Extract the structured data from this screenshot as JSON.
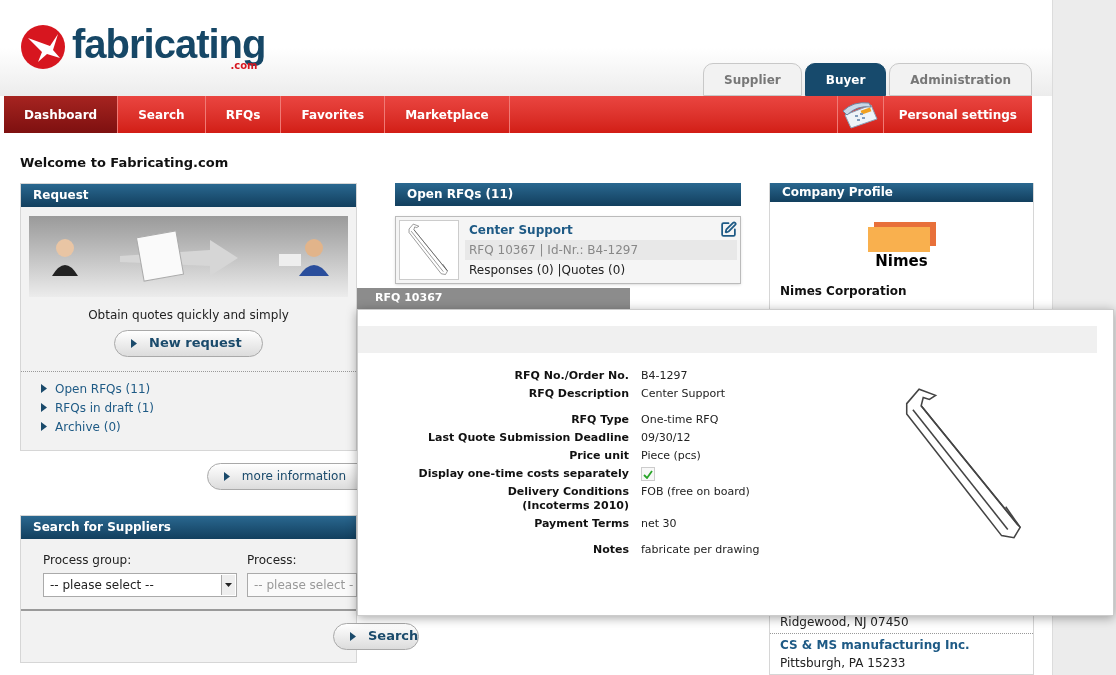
{
  "logo": {
    "name": "fabricating",
    "suffix": ".com"
  },
  "role_tabs": [
    {
      "label": "Supplier",
      "selected": false
    },
    {
      "label": "Buyer",
      "selected": true
    },
    {
      "label": "Administration",
      "selected": false
    }
  ],
  "nav": {
    "items": [
      {
        "label": "Dashboard",
        "selected": true
      },
      {
        "label": "Search",
        "selected": false
      },
      {
        "label": "RFQs",
        "selected": false
      },
      {
        "label": "Favorites",
        "selected": false
      },
      {
        "label": "Marketplace",
        "selected": false
      }
    ],
    "personal_settings": "Personal settings"
  },
  "welcome": "Welcome to Fabricating.com",
  "request": {
    "title": "Request",
    "tagline": "Obtain quotes quickly and simply",
    "button": "New request",
    "links": [
      "Open RFQs (11)",
      "RFQs in draft (1)",
      "Archive (0)"
    ],
    "more_button": "more information"
  },
  "supplier_search": {
    "title": "Search for Suppliers",
    "fields": [
      {
        "label": "Process group:",
        "value": "-- please select --",
        "disabled": false
      },
      {
        "label": "Process:",
        "value": "-- please select -",
        "disabled": true
      }
    ],
    "button": "Search"
  },
  "open_rfqs": {
    "title": "Open RFQs (11)",
    "cards": [
      {
        "title": "Center Support",
        "meta": "RFQ 10367 | Id-Nr.: B4-1297",
        "counts": "Responses (0) |Quotes (0)"
      }
    ]
  },
  "company_profile": {
    "title": "Company Profile",
    "logo_text": "Nimes",
    "name": "Nimes Corporation",
    "suppliers": [
      {
        "location": "Ridgewood, NJ 07450"
      },
      {
        "name": "CS & MS manufacturing Inc.",
        "location": "Pittsburgh, PA 15233"
      }
    ]
  },
  "rfq_popup": {
    "title": "RFQ 10367",
    "groups": [
      [
        {
          "kind": "text",
          "label": "RFQ No./Order No.",
          "value": "B4-1297"
        },
        {
          "kind": "text",
          "label": "RFQ Description",
          "value": "Center Support"
        }
      ],
      [
        {
          "kind": "text",
          "label": "RFQ Type",
          "value": "One-time RFQ"
        },
        {
          "kind": "text",
          "label": "Last Quote Submission Deadline",
          "value": "09/30/12"
        },
        {
          "kind": "text",
          "label": "Price unit",
          "value": "Piece (pcs)"
        },
        {
          "kind": "checkbox",
          "label": "Display one-time costs separately",
          "checked": true
        },
        {
          "kind": "text",
          "label": "Delivery Conditions\n(Incoterms 2010)",
          "value": "FOB (free on board)"
        },
        {
          "kind": "text",
          "label": "Payment Terms",
          "value": "net 30"
        }
      ],
      [
        {
          "kind": "text",
          "label": "Notes",
          "value": "fabricate per drawing"
        }
      ]
    ]
  }
}
